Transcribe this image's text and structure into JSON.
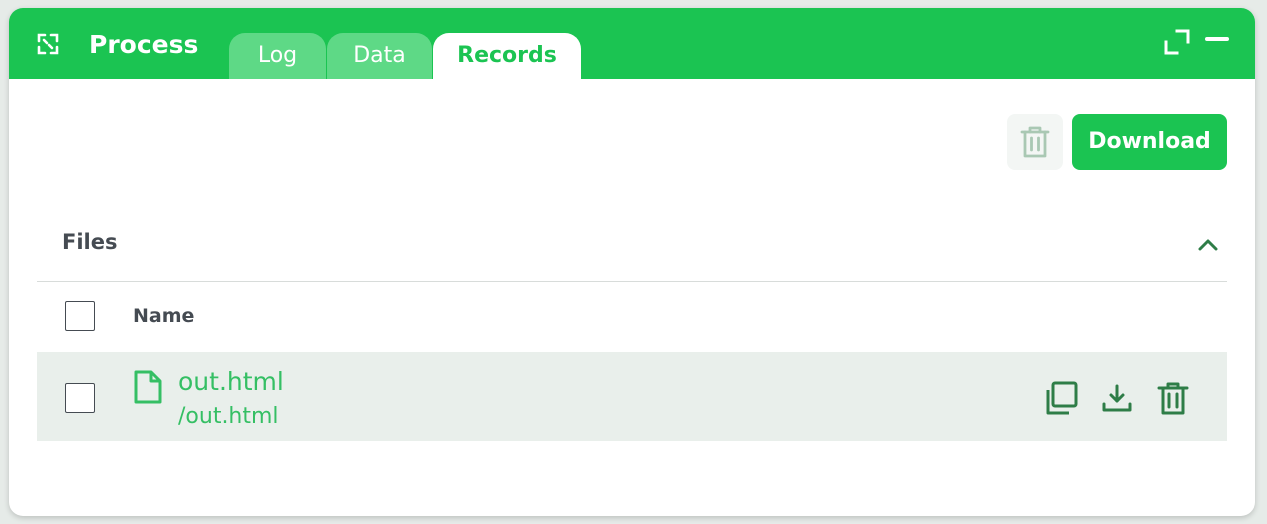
{
  "header": {
    "title": "Process",
    "tabs": [
      {
        "label": "Log",
        "active": false
      },
      {
        "label": "Data",
        "active": false
      },
      {
        "label": "Records",
        "active": true
      }
    ],
    "icons": [
      "process-icon",
      "expand-icon",
      "minimize-icon"
    ]
  },
  "toolbar": {
    "delete_icon": "trash-icon",
    "download_label": "Download"
  },
  "files": {
    "section_title": "Files",
    "column_name": "Name",
    "rows": [
      {
        "name": "out.html",
        "path": "/out.html",
        "actions": [
          "copy-icon",
          "download-icon",
          "trash-icon"
        ]
      }
    ]
  },
  "colors": {
    "accent": "#1bc452",
    "tab_inactive": "#5ed986",
    "file_text": "#35bf64",
    "action_icon": "#2e7d47",
    "disabled_icon": "#a9c8b3",
    "row_bg": "#e9efeb",
    "heading_text": "#454b52"
  }
}
